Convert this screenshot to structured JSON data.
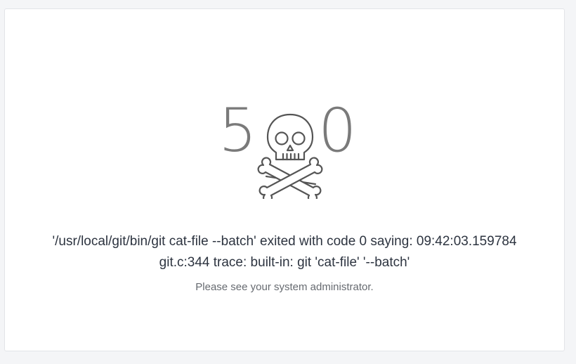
{
  "error": {
    "code_first_digit": "5",
    "code_last_digit": "0",
    "icon": "skull-crossbones-icon",
    "message_line1": "'/usr/local/git/bin/git cat-file --batch' exited with code 0 saying: 09:42:03.159784",
    "message_line2": "git.c:344 trace: built-in: git 'cat-file' '--batch'",
    "hint": "Please see your system administrator."
  },
  "colors": {
    "page_background": "#f4f5f7",
    "card_background": "#ffffff",
    "icon_stroke": "#555555",
    "message_text": "#2d3440",
    "hint_text": "#666a70"
  }
}
